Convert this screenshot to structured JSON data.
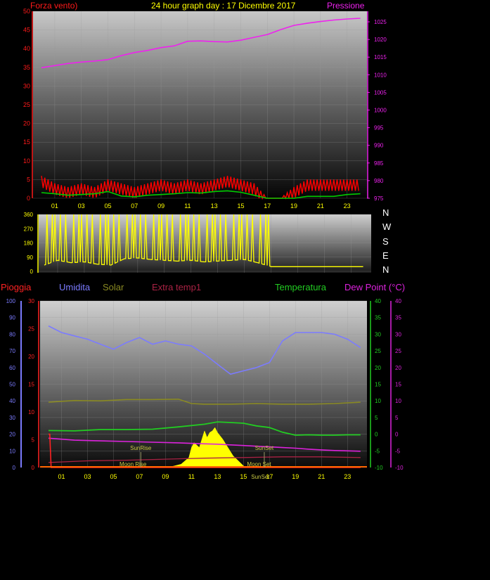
{
  "header": {
    "left_label": "Forza vento)",
    "center_title": "24 hour graph day : 17 Dicembre 2017",
    "right_label": "Pressione"
  },
  "colors": {
    "wind": "#ff0000",
    "gust": "#00cc00",
    "pressure": "#ee22ee",
    "direction": "#ffff00",
    "rain": "#ff2222",
    "humidity": "#7b7bff",
    "solar": "#8a8a22",
    "extra_temp": "#aa2244",
    "temperature": "#22cc22",
    "dew_point": "#dd22dd",
    "x_ticks": "#ffff00"
  },
  "chart_data": [
    {
      "type": "line",
      "title": "24 hour graph day : 17 Dicembre 2017",
      "x_ticks": [
        "01",
        "03",
        "05",
        "07",
        "09",
        "11",
        "13",
        "15",
        "17",
        "19",
        "21",
        "23"
      ],
      "y_left_label": "Forza vento)",
      "y_left_ticks": [
        "50",
        "45",
        "40",
        "35",
        "30",
        "25",
        "20",
        "15",
        "10",
        "5",
        "0"
      ],
      "ylim_left": [
        0,
        50
      ],
      "y_right_label": "Pressione",
      "y_right_ticks": [
        "1025",
        "1020",
        "1015",
        "1010",
        "1005",
        "1000",
        "995",
        "990",
        "985",
        "980",
        "975"
      ],
      "ylim_right": [
        975,
        1028
      ],
      "series": [
        {
          "name": "Pressione",
          "axis": "right",
          "x": [
            0,
            1,
            2,
            3,
            4,
            5,
            6,
            7,
            8,
            9,
            10,
            11,
            12,
            13,
            14,
            15,
            16,
            17,
            18,
            19,
            20,
            21,
            22,
            23,
            24
          ],
          "values": [
            1012.0,
            1012.6,
            1013.2,
            1013.6,
            1013.9,
            1014.3,
            1015.4,
            1016.3,
            1016.9,
            1017.7,
            1018.2,
            1019.5,
            1019.6,
            1019.4,
            1019.3,
            1019.8,
            1020.6,
            1021.4,
            1022.8,
            1024.0,
            1024.6,
            1025.1,
            1025.5,
            1025.8,
            1026.0
          ]
        },
        {
          "name": "Vento",
          "axis": "left",
          "x": [
            0,
            1,
            2,
            3,
            4,
            5,
            6,
            7,
            8,
            9,
            10,
            11,
            12,
            13,
            14,
            15,
            16,
            17,
            18,
            19,
            20,
            21,
            22,
            23,
            24
          ],
          "values": [
            6,
            4,
            3,
            4,
            3,
            5,
            4,
            3,
            4,
            5,
            4,
            5,
            4,
            5,
            6,
            5,
            4,
            0,
            0,
            3,
            5,
            5,
            5,
            5,
            5
          ]
        },
        {
          "name": "Raffica",
          "axis": "left",
          "x": [
            0,
            1,
            2,
            3,
            4,
            5,
            6,
            7,
            8,
            9,
            10,
            11,
            12,
            13,
            14,
            15,
            16,
            17,
            18,
            19,
            20,
            21,
            22,
            23,
            24
          ],
          "values": [
            1.5,
            1.2,
            0.8,
            1.0,
            1.2,
            1.8,
            0.6,
            0.4,
            0.8,
            1.0,
            1.2,
            1.5,
            1.4,
            1.8,
            2.0,
            1.6,
            0.8,
            0,
            0,
            0,
            0.5,
            0.5,
            0.5,
            1.0,
            1.2
          ]
        }
      ]
    },
    {
      "type": "line",
      "y_ticks": [
        "360",
        "270",
        "180",
        "90",
        "0"
      ],
      "ylim": [
        0,
        360
      ],
      "compass_labels": [
        "N",
        "W",
        "S",
        "E",
        "N"
      ],
      "series": [
        {
          "name": "Direzione vento",
          "x": [
            0,
            1,
            2,
            3,
            4,
            5,
            6,
            7,
            8,
            9,
            10,
            11,
            12,
            13,
            14,
            15,
            16,
            17,
            18,
            19,
            20,
            21,
            22,
            23,
            24
          ],
          "values": [
            40,
            70,
            55,
            60,
            45,
            40,
            80,
            85,
            75,
            70,
            65,
            70,
            60,
            65,
            70,
            75,
            55,
            30,
            30,
            30,
            30,
            30,
            30,
            30,
            30
          ]
        }
      ]
    },
    {
      "type": "line",
      "legend": [
        "Pioggia",
        "Umidita",
        "Solar",
        "Extra temp1",
        "Temperatura",
        "Dew Point (°C)"
      ],
      "x_ticks": [
        "01",
        "03",
        "05",
        "07",
        "09",
        "11",
        "13",
        "15",
        "17",
        "19",
        "21",
        "23"
      ],
      "y_humidity_ticks": [
        "100",
        "90",
        "80",
        "70",
        "60",
        "50",
        "40",
        "30",
        "20",
        "10",
        "0"
      ],
      "y_rain_ticks": [
        "30",
        "25",
        "20",
        "15",
        "10",
        "5",
        "0"
      ],
      "y_temp_ticks": [
        "40",
        "35",
        "30",
        "25",
        "20",
        "15",
        "10",
        "5",
        "0",
        "-5",
        "-10"
      ],
      "y_dew_ticks": [
        "40",
        "35",
        "30",
        "25",
        "20",
        "15",
        "10",
        "5",
        "0",
        "-5",
        "-10"
      ],
      "annotations": {
        "sunrise": "SunRise",
        "sunset": "SunSet",
        "moonrise": "Moon Rise",
        "moonset": "Moon Set",
        "sunset_axis": "SunSet"
      },
      "series": [
        {
          "name": "Umidita",
          "axis": "humidity",
          "x": [
            0,
            1,
            2,
            3,
            4,
            5,
            6,
            7,
            8,
            9,
            10,
            11,
            12,
            13,
            14,
            15,
            16,
            17,
            18,
            19,
            20,
            21,
            22,
            23,
            24
          ],
          "values": [
            85,
            81,
            79,
            77,
            74,
            71,
            75,
            78,
            74,
            76,
            74,
            73,
            68,
            62,
            56,
            58,
            60,
            63,
            76,
            81,
            81,
            81,
            80,
            77,
            72
          ]
        },
        {
          "name": "Solar",
          "axis": "temp",
          "x": [
            0,
            2,
            4,
            6,
            8,
            10,
            11,
            12,
            14,
            16,
            18,
            20,
            22,
            24
          ],
          "values": [
            9.6,
            10.1,
            10.0,
            10.4,
            10.4,
            10.5,
            9.2,
            9.0,
            9.0,
            9.2,
            9.0,
            9.0,
            9.2,
            9.6
          ]
        },
        {
          "name": "Temperatura",
          "axis": "temp",
          "x": [
            0,
            2,
            4,
            6,
            8,
            10,
            12,
            13,
            14,
            15,
            16,
            17,
            18,
            19,
            20,
            21,
            22,
            23,
            24
          ],
          "values": [
            1.1,
            1.0,
            1.4,
            1.4,
            1.5,
            2.2,
            3.0,
            3.7,
            3.5,
            3.3,
            2.5,
            2.0,
            0.6,
            -0.3,
            -0.2,
            -0.3,
            -0.3,
            -0.2,
            -0.2
          ]
        },
        {
          "name": "Dew Point (°C)",
          "axis": "temp",
          "x": [
            0,
            2,
            4,
            6,
            8,
            10,
            12,
            13,
            14,
            15,
            16,
            17,
            18,
            19,
            20,
            21,
            22,
            23,
            24
          ],
          "values": [
            -1.2,
            -1.8,
            -2.0,
            -2.2,
            -2.4,
            -2.6,
            -2.9,
            -3.0,
            -3.2,
            -3.4,
            -3.6,
            -3.8,
            -4.0,
            -4.2,
            -4.5,
            -4.7,
            -4.9,
            -5.0,
            -5.1
          ]
        },
        {
          "name": "Extra temp1",
          "axis": "temp",
          "x": [
            0,
            3,
            6,
            9,
            12,
            15,
            18,
            21,
            24
          ],
          "values": [
            -8.5,
            -8.0,
            -7.8,
            -7.5,
            -7.2,
            -7.0,
            -6.8,
            -6.8,
            -7.0
          ]
        },
        {
          "name": "Pioggia",
          "axis": "rain",
          "x": [
            0,
            0.1,
            0.2,
            0.3,
            24
          ],
          "values": [
            6,
            6,
            0,
            0,
            0
          ]
        },
        {
          "name": "Radiazione",
          "axis": "temp",
          "x": [
            8.8,
            9.6,
            10.2,
            10.8,
            11.0,
            11.2,
            11.6,
            11.8,
            12.0,
            12.2,
            12.4,
            12.6,
            12.8,
            13.0,
            13.4,
            13.8,
            14.2,
            14.6,
            15.0,
            15.2
          ],
          "values": [
            -10,
            -9.6,
            -9.0,
            -7.0,
            -4.0,
            -2.5,
            -4.0,
            -1.5,
            1.0,
            -1.0,
            0.5,
            1.0,
            2.0,
            0.5,
            -1.5,
            -4.0,
            -6.5,
            -8.0,
            -9.5,
            -10
          ]
        }
      ]
    }
  ]
}
